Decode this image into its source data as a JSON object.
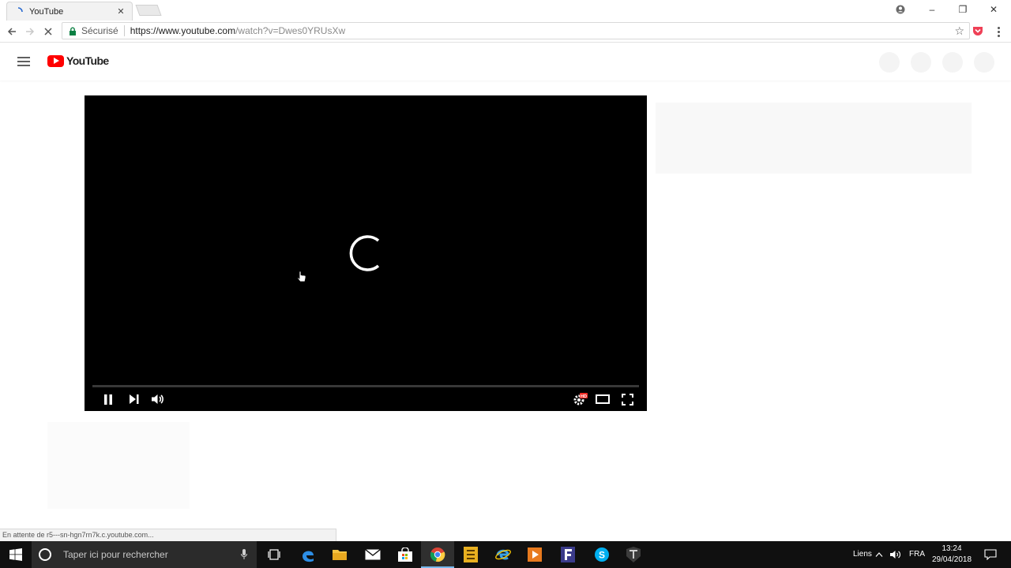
{
  "browser": {
    "tab": {
      "title": "YouTube",
      "close_icon": "close-icon"
    },
    "window_controls": {
      "profile_icon": "person-icon",
      "minimize": "–",
      "restore": "❐",
      "close": "✕"
    },
    "address_bar": {
      "secure_label": "Sécurisé",
      "url_host": "https://www.youtube.com",
      "url_path": "/watch?v=Dwes0YRUsXw"
    },
    "status_text": "En attente de r5---sn-hgn7rn7k.c.youtube.com..."
  },
  "youtube": {
    "brand": "YouTube",
    "colors": {
      "brand_red": "#ff0000",
      "player_bg": "#000000"
    }
  },
  "player": {
    "state": "buffering",
    "controls": [
      "pause-icon",
      "next-icon",
      "volume-icon",
      "settings-hd-icon",
      "theater-mode-icon",
      "fullscreen-icon"
    ],
    "settings_badge": "HD"
  },
  "taskbar": {
    "search_placeholder": "Taper ici pour rechercher",
    "apps": [
      "task-view-icon",
      "edge-icon",
      "file-explorer-icon",
      "mail-icon",
      "store-icon",
      "chrome-icon",
      "app-f-icon",
      "internet-explorer-icon",
      "media-player-icon",
      "app-f2-icon",
      "skype-icon",
      "tank-game-icon"
    ],
    "tray": {
      "links_label": "Liens",
      "language": "FRA",
      "time": "13:24",
      "date": "29/04/2018"
    }
  }
}
